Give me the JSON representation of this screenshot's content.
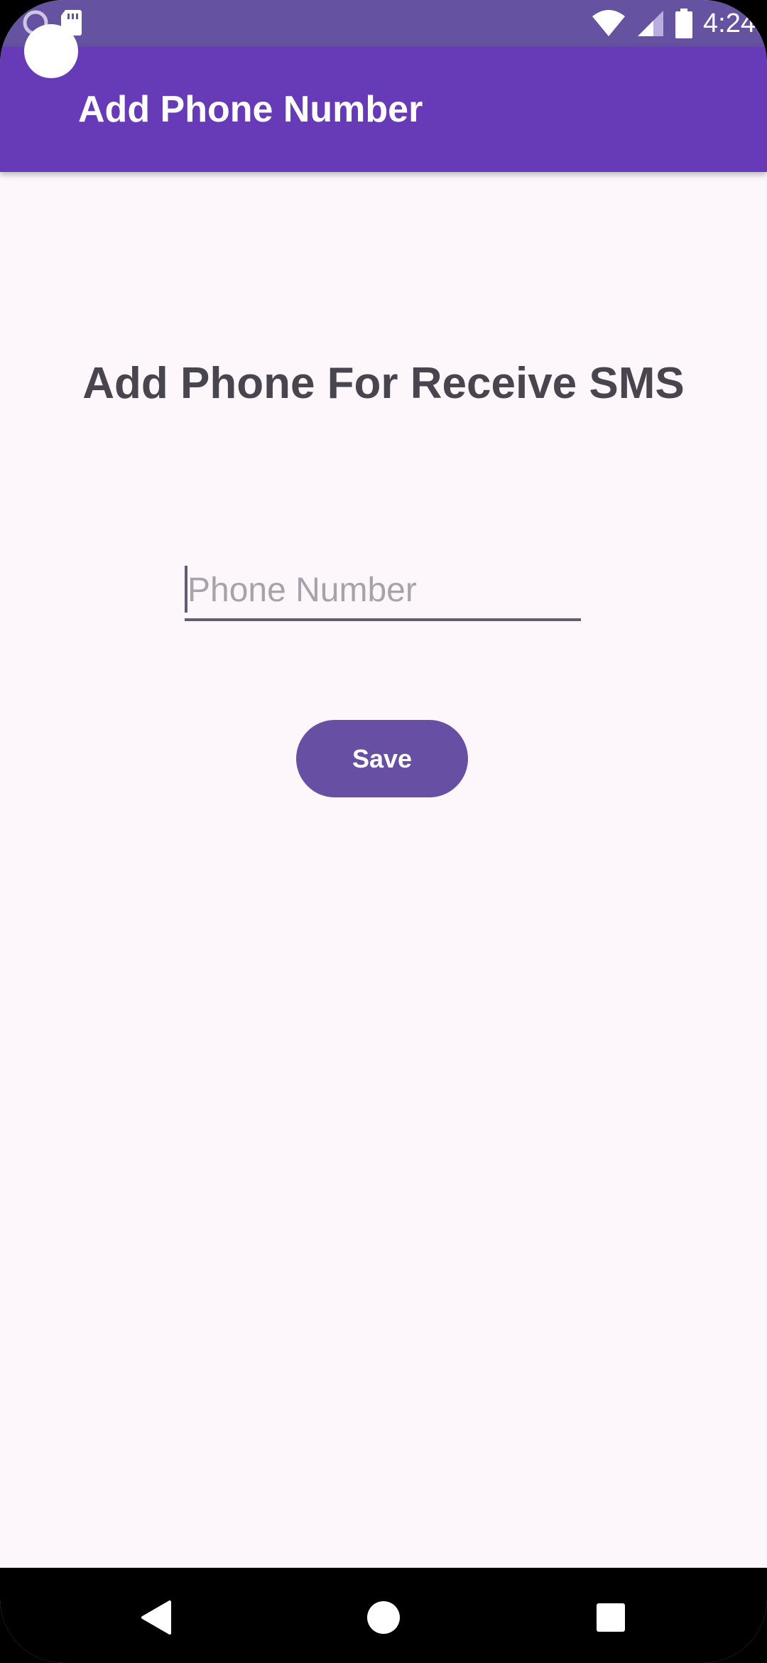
{
  "status_bar": {
    "time": "4:24",
    "icons": [
      "media-circle-icon",
      "sd-card-icon",
      "wifi-icon",
      "cell-signal-icon",
      "battery-icon"
    ]
  },
  "app_bar": {
    "title": "Add Phone Number"
  },
  "main": {
    "heading": "Add Phone For Receive SMS",
    "phone_input": {
      "value": "",
      "placeholder": "Phone Number"
    },
    "save_label": "Save"
  },
  "nav_bar": {
    "icons": [
      "back-icon",
      "home-icon",
      "recents-icon"
    ]
  },
  "colors": {
    "status_bar": "#6552a1",
    "app_bar": "#673ab7",
    "background": "#fdf7fc",
    "primary_button": "#6750a4",
    "heading_text": "#49454f"
  }
}
